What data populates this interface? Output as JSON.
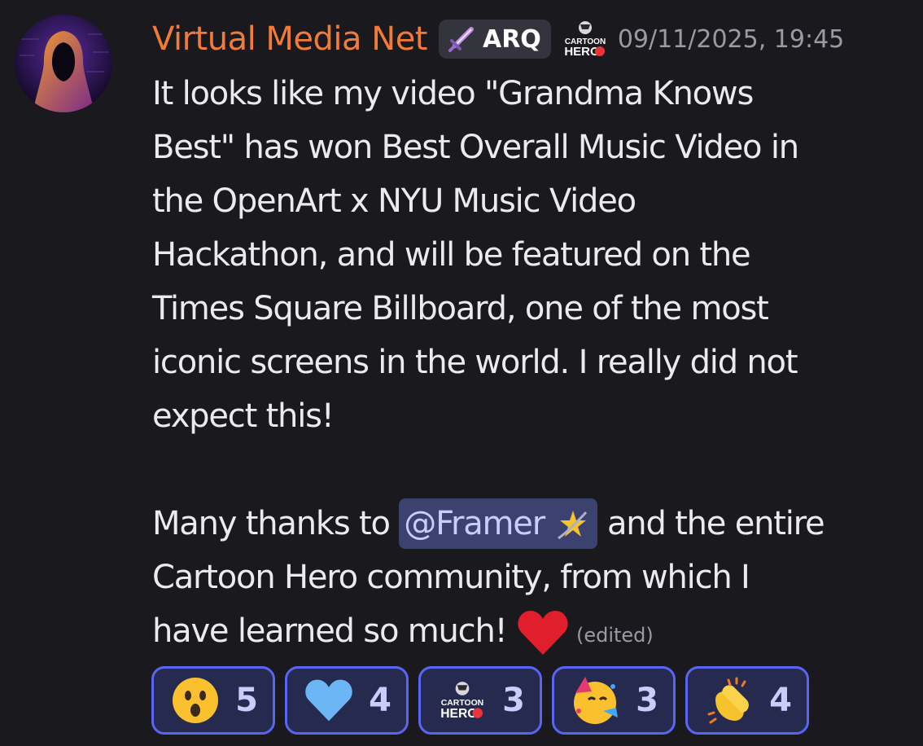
{
  "message": {
    "author": "Virtual Media Net",
    "tag": "ARQ",
    "timestamp": "09/11/2025, 19:45",
    "lines_para1": [
      "It looks like my video \"Grandma Knows",
      "Best\" has won Best Overall Music Video in",
      "the OpenArt x NYU Music Video",
      "Hackathon, and will be featured on the",
      "Times Square Billboard, one of the most",
      "iconic screens in the world. I really did not",
      "expect this!"
    ],
    "para2_before_mention": "Many thanks to ",
    "mention": "@Framer",
    "para2_after_mention": " and the entire",
    "lines_para2": [
      "Cartoon Hero community, from which I"
    ],
    "last_line": "have learned so much! ",
    "edited": "(edited)"
  },
  "badge_text": {
    "line1": "CARTOON",
    "line2": "HERO"
  },
  "reactions": [
    {
      "emoji": "astonished-face",
      "count": "5"
    },
    {
      "emoji": "blue-heart",
      "count": "4"
    },
    {
      "emoji": "cartoon-hero-server-emoji",
      "count": "3"
    },
    {
      "emoji": "partying-face",
      "count": "3"
    },
    {
      "emoji": "clapping-hands",
      "count": "4"
    }
  ],
  "colors": {
    "background": "#1a1a1e",
    "username": "#f47b35",
    "mention_bg": "#3c4270",
    "reaction_border": "#5865f2"
  }
}
